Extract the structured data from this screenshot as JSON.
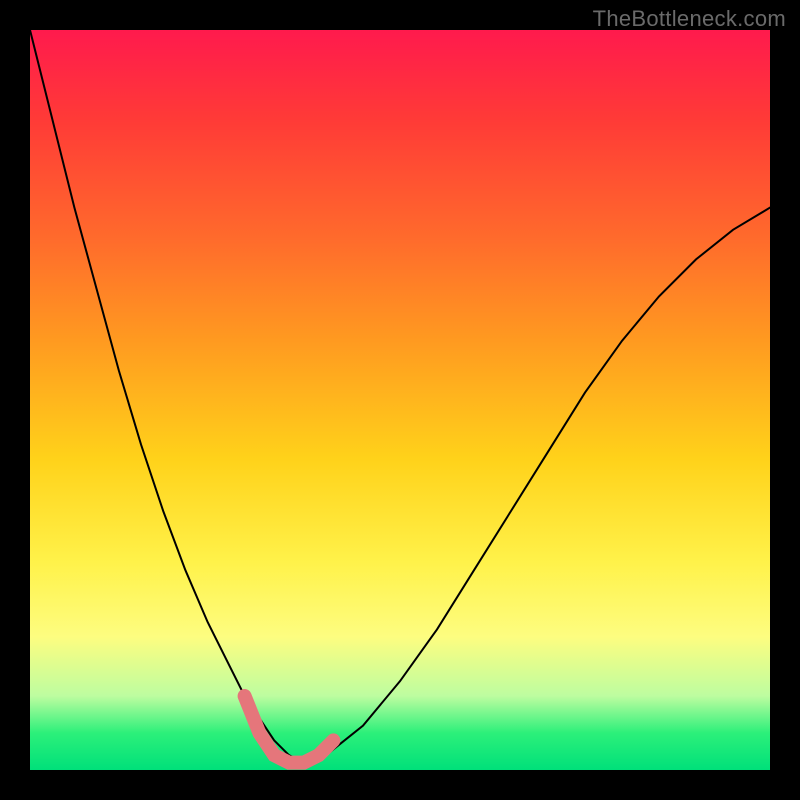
{
  "watermark": "TheBottleneck.com",
  "chart_data": {
    "type": "line",
    "title": "",
    "xlabel": "",
    "ylabel": "",
    "xlim": [
      0,
      100
    ],
    "ylim": [
      0,
      100
    ],
    "grid": false,
    "background_gradient": [
      {
        "pos": 0,
        "color": "#ff1a4d"
      },
      {
        "pos": 12,
        "color": "#ff3a37"
      },
      {
        "pos": 28,
        "color": "#ff6a2c"
      },
      {
        "pos": 42,
        "color": "#ff9a20"
      },
      {
        "pos": 58,
        "color": "#ffd21a"
      },
      {
        "pos": 72,
        "color": "#fff24a"
      },
      {
        "pos": 82,
        "color": "#fdfd80"
      },
      {
        "pos": 90,
        "color": "#bdfda0"
      },
      {
        "pos": 95,
        "color": "#2cf07a"
      },
      {
        "pos": 100,
        "color": "#00e07a"
      }
    ],
    "series": [
      {
        "name": "bottleneck_curve",
        "stroke": "#000000",
        "x": [
          0,
          3,
          6,
          9,
          12,
          15,
          18,
          21,
          24,
          27,
          29,
          31,
          33,
          35,
          37,
          40,
          45,
          50,
          55,
          60,
          65,
          70,
          75,
          80,
          85,
          90,
          95,
          100
        ],
        "y": [
          100,
          88,
          76,
          65,
          54,
          44,
          35,
          27,
          20,
          14,
          10,
          7,
          4,
          2,
          1,
          2,
          6,
          12,
          19,
          27,
          35,
          43,
          51,
          58,
          64,
          69,
          73,
          76
        ]
      },
      {
        "name": "optimal_highlight",
        "stroke": "#e5767b",
        "x": [
          29,
          31,
          33,
          35,
          37,
          39,
          41
        ],
        "y": [
          10,
          5,
          2,
          1,
          1,
          2,
          4
        ]
      }
    ]
  }
}
